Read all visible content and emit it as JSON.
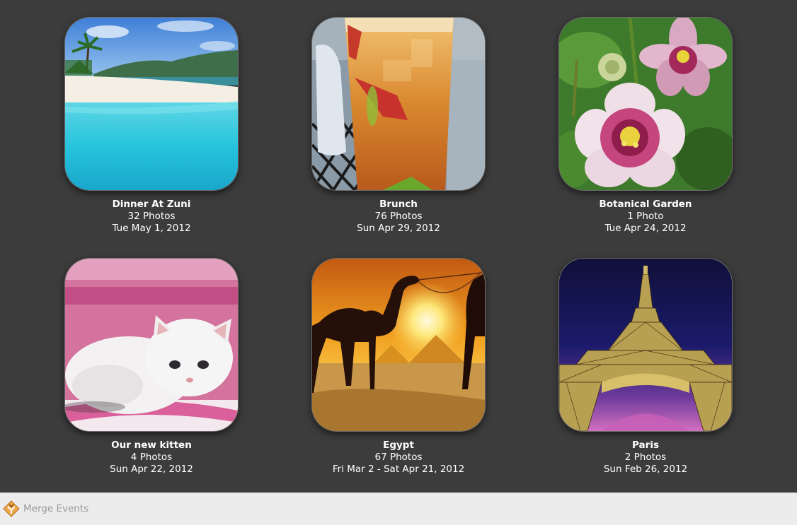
{
  "events": [
    {
      "title": "Dinner At Zuni",
      "count": "32 Photos",
      "date": "Tue May 1, 2012",
      "thumbnail": "beach-photo"
    },
    {
      "title": "Brunch",
      "count": "76 Photos",
      "date": "Sun Apr 29, 2012",
      "thumbnail": "cocktail-photo"
    },
    {
      "title": "Botanical Garden",
      "count": "1 Photo",
      "date": "Tue Apr 24, 2012",
      "thumbnail": "flowers-photo"
    },
    {
      "title": "Our new kitten",
      "count": "4 Photos",
      "date": "Sun Apr 22, 2012",
      "thumbnail": "kitten-photo"
    },
    {
      "title": "Egypt",
      "count": "67 Photos",
      "date": "Fri Mar 2 - Sat Apr 21, 2012",
      "thumbnail": "camel-pyramids-photo"
    },
    {
      "title": "Paris",
      "count": "2 Photos",
      "date": "Sun Feb 26, 2012",
      "thumbnail": "eiffel-tower-photo"
    }
  ],
  "toolbar": {
    "merge_label": "Merge Events",
    "merge_enabled": false,
    "merge_icon": "merge-events-icon"
  },
  "colors": {
    "background": "#3c3c3c",
    "toolbar_background": "#ececec",
    "text": "#ffffff",
    "disabled_text": "#9a9a9a"
  }
}
